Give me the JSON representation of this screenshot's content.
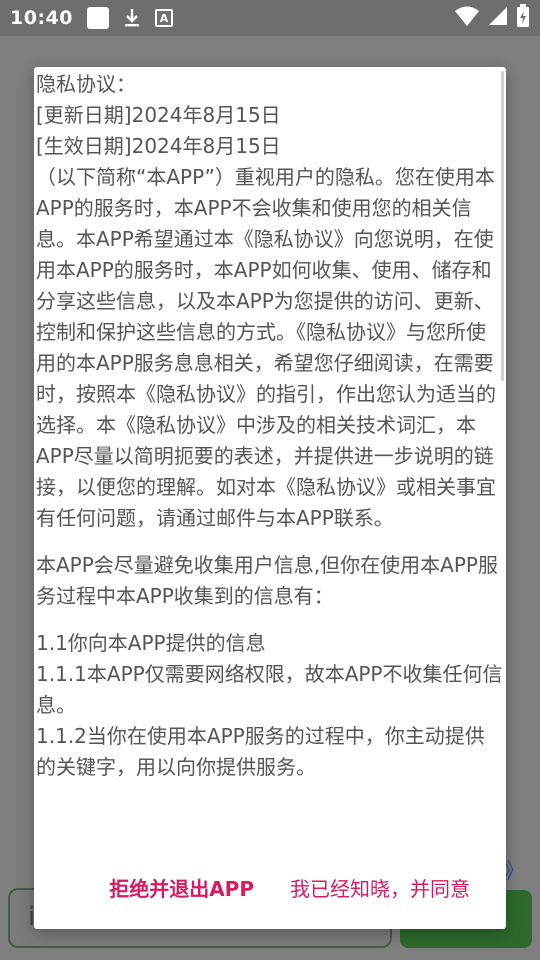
{
  "status_bar": {
    "time": "10:40",
    "icons": [
      "notification-square-icon",
      "download-icon",
      "text-a-icon",
      "wifi-icon",
      "signal-icon",
      "battery-icon"
    ]
  },
  "background": {
    "input_hint": "i"
  },
  "dialog": {
    "paragraphs": [
      "隐私协议：",
      " [更新日期]2024年8月15日",
      " [生效日期]2024年8月15日",
      " （以下简称“本APP”）重视用户的隐私。您在使用本APP的服务时，本APP不会收集和使用您的相关信息。本APP希望通过本《隐私协议》向您说明，在使用本APP的服务时，本APP如何收集、使用、储存和分享这些信息，以及本APP为您提供的访问、更新、控制和保护这些信息的方式。《隐私协议》与您所使用的本APP服务息息相关，希望您仔细阅读，在需要时，按照本《隐私协议》的指引，作出您认为适当的选择。本《隐私协议》中涉及的相关技术词汇，本APP尽量以简明扼要的表述，并提供进一步说明的链接，以便您的理解。如对本《隐私协议》或相关事宜有任何问题，请通过邮件与本APP联系。",
      " 本APP会尽量避免收集用户信息,但你在使用本APP服务过程中本APP收集到的信息有：",
      "  1.1你向本APP提供的信息",
      " 1.1.1本APP仅需要网络权限，故本APP不收集任何信息。",
      " 1.1.2当你在使用本APP服务的过程中，你主动提供的关键字，用以向你提供服务。"
    ],
    "buttons": {
      "reject": "拒绝并退出APP",
      "agree": "我已经知晓，并同意"
    },
    "accent_color": "#d81b60"
  }
}
